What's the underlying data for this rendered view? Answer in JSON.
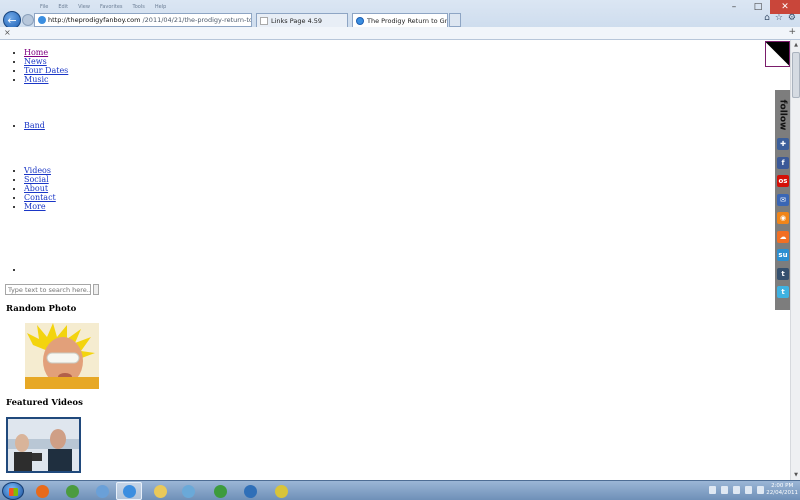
{
  "browser": {
    "menu": [
      "File",
      "Edit",
      "View",
      "Favorites",
      "Tools",
      "Help"
    ],
    "user_label": "",
    "address": {
      "domain": "http://theprodigyfanboy.com",
      "path": "/2011/04/21/the-prodigy-return-to-greece-"
    },
    "tabs": [
      {
        "label": "Links Page 4.59"
      },
      {
        "label": "The Prodigy Return to Gree..."
      }
    ]
  },
  "nav": {
    "group1": [
      "Home",
      "News",
      "Tour Dates",
      "Music"
    ],
    "group2": [
      "Band"
    ],
    "group3": [
      "Videos",
      "Social",
      "About",
      "Contact",
      "More"
    ]
  },
  "search": {
    "placeholder": "Type text to search here..."
  },
  "sections": {
    "random_photo": "Random Photo",
    "featured_videos": "Featured Videos"
  },
  "follow": {
    "label": "follow",
    "icons": [
      {
        "name": "myspace-icon",
        "glyph": "✚",
        "color": "#3c5f9a"
      },
      {
        "name": "facebook-icon",
        "glyph": "f",
        "color": "#3b5998"
      },
      {
        "name": "lastfm-icon",
        "glyph": "os",
        "color": "#d51007"
      },
      {
        "name": "email-icon",
        "glyph": "✉",
        "color": "#3a66b5"
      },
      {
        "name": "rss-icon",
        "glyph": "◉",
        "color": "#f0851a"
      },
      {
        "name": "soundcloud-icon",
        "glyph": "☁",
        "color": "#f26f23"
      },
      {
        "name": "stumbleupon-icon",
        "glyph": "su",
        "color": "#2b8fd1"
      },
      {
        "name": "tumblr-icon",
        "glyph": "t",
        "color": "#35506e"
      },
      {
        "name": "twitter-icon",
        "glyph": "t",
        "color": "#3fb2e2"
      }
    ]
  },
  "taskbar": {
    "apps": [
      {
        "name": "firefox-taskbar-icon",
        "color": "#e86a1a"
      },
      {
        "name": "chrome-taskbar-icon",
        "color": "#4b9b3f"
      },
      {
        "name": "itunes-taskbar-icon",
        "color": "#6aa0d8"
      },
      {
        "name": "ie-taskbar-icon",
        "color": "#3b8ee0",
        "active": true
      },
      {
        "name": "explorer-taskbar-icon",
        "color": "#e9c95a"
      },
      {
        "name": "notepad-taskbar-icon",
        "color": "#6aa9d8"
      },
      {
        "name": "utorrent-taskbar-icon",
        "color": "#3d9b3d"
      },
      {
        "name": "media-player-taskbar-icon",
        "color": "#2f6fb8"
      },
      {
        "name": "fireworks-taskbar-icon",
        "color": "#d8c43a"
      }
    ],
    "time": "2:00 PM",
    "date": "22/04/2011"
  }
}
